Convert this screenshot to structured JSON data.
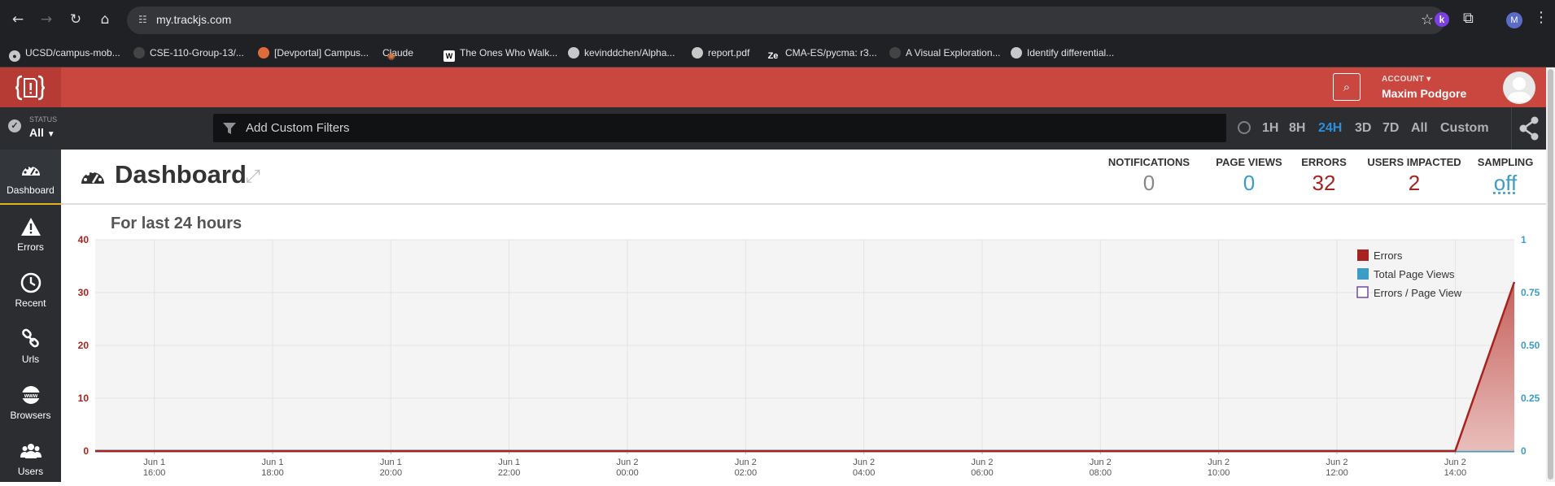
{
  "browser": {
    "url": "my.trackjs.com",
    "ext_k": "k",
    "profile_initial": "M",
    "bookmarks": [
      {
        "label": "UCSD/campus-mob...",
        "icon": "github-icon"
      },
      {
        "label": "CSE-110-Group-13/...",
        "icon": "github-icon"
      },
      {
        "label": "[Devportal] Campus...",
        "icon": "devportal-icon"
      },
      {
        "label": "Claude",
        "icon": "claude-icon"
      },
      {
        "label": "The Ones Who Walk...",
        "icon": "wikipedia-icon"
      },
      {
        "label": "kevinddchen/Alpha...",
        "icon": "github-icon"
      },
      {
        "label": "report.pdf",
        "icon": "globe-icon"
      },
      {
        "label": "CMA-ES/pycma: r3...",
        "icon": "ze-icon"
      },
      {
        "label": "A Visual Exploration...",
        "icon": "distill-icon"
      },
      {
        "label": "Identify differential...",
        "icon": "github-icon"
      }
    ]
  },
  "header": {
    "account_label": "ACCOUNT",
    "account_name": "Maxim Podgore"
  },
  "filters": {
    "status_label": "STATUS",
    "status_value": "All",
    "placeholder": "Add Custom Filters",
    "ranges": [
      "1H",
      "8H",
      "24H",
      "3D",
      "7D",
      "All",
      "Custom"
    ],
    "active_range": "24H"
  },
  "sidebar": {
    "items": [
      {
        "label": "Dashboard",
        "icon": "gauge-icon",
        "active": true
      },
      {
        "label": "Errors",
        "icon": "warning-icon"
      },
      {
        "label": "Recent",
        "icon": "clock-icon"
      },
      {
        "label": "Urls",
        "icon": "link-icon"
      },
      {
        "label": "Browsers",
        "icon": "www-icon"
      },
      {
        "label": "Users",
        "icon": "users-icon"
      }
    ]
  },
  "dashboard": {
    "title": "Dashboard",
    "subtitle": "For last 24 hours",
    "stats": [
      {
        "label": "NOTIFICATIONS",
        "value": "0",
        "color": "#888888"
      },
      {
        "label": "PAGE VIEWS",
        "value": "0",
        "color": "#3a9cc7"
      },
      {
        "label": "ERRORS",
        "value": "32",
        "color": "#a8231f"
      },
      {
        "label": "USERS IMPACTED",
        "value": "2",
        "color": "#a8231f"
      },
      {
        "label": "SAMPLING",
        "value": "off",
        "color": "#3a9cc7"
      }
    ]
  },
  "chart_data": {
    "type": "area",
    "x_ticks": [
      {
        "date": "Jun 1",
        "time": "16:00"
      },
      {
        "date": "Jun 1",
        "time": "18:00"
      },
      {
        "date": "Jun 1",
        "time": "20:00"
      },
      {
        "date": "Jun 1",
        "time": "22:00"
      },
      {
        "date": "Jun 2",
        "time": "00:00"
      },
      {
        "date": "Jun 2",
        "time": "02:00"
      },
      {
        "date": "Jun 2",
        "time": "04:00"
      },
      {
        "date": "Jun 2",
        "time": "06:00"
      },
      {
        "date": "Jun 2",
        "time": "08:00"
      },
      {
        "date": "Jun 2",
        "time": "10:00"
      },
      {
        "date": "Jun 2",
        "time": "12:00"
      },
      {
        "date": "Jun 2",
        "time": "14:00"
      }
    ],
    "y_left": {
      "ticks": [
        "0",
        "10",
        "20",
        "30",
        "40"
      ],
      "range": [
        0,
        40
      ],
      "color": "#a8231f"
    },
    "y_right": {
      "ticks": [
        "0",
        "0.25",
        "0.50",
        "0.75",
        "1"
      ],
      "range": [
        0,
        1
      ],
      "color": "#3a9cc7"
    },
    "series": [
      {
        "name": "Errors",
        "color": "#a8231f",
        "points": [
          [
            "Jun 1 15:00",
            0
          ],
          [
            "Jun 2 14:00",
            0
          ],
          [
            "Jun 2 15:00",
            32
          ]
        ]
      },
      {
        "name": "Total Page Views",
        "color": "#3a9cc7",
        "points": [
          [
            "Jun 1 15:00",
            0
          ],
          [
            "Jun 2 15:00",
            0
          ]
        ]
      },
      {
        "name": "Errors / Page View",
        "color": "#6a4fa0",
        "points": []
      }
    ],
    "legend_position": "top-right",
    "grid": true
  }
}
